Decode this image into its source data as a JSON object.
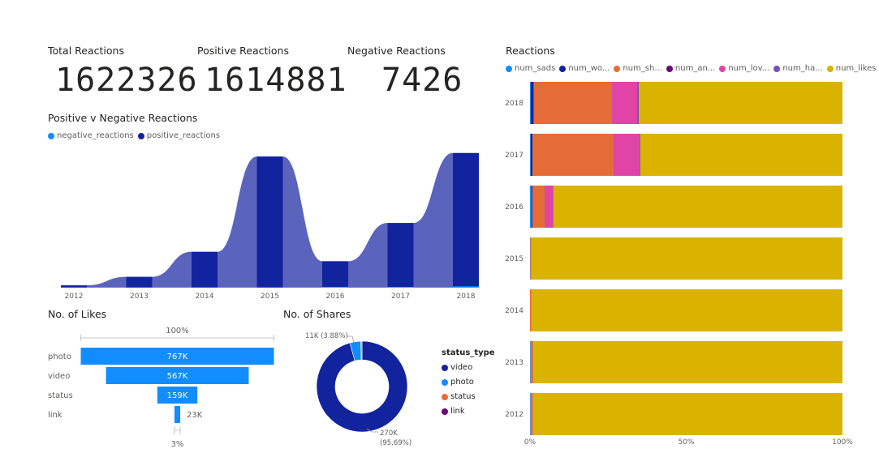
{
  "cards": [
    {
      "title": "Total Reactions",
      "value": "1622326"
    },
    {
      "title": "Positive Reactions",
      "value": "1614881"
    },
    {
      "title": "Negative Reactions",
      "value": "7426"
    }
  ],
  "ribbon_title": "Positive v Negative Reactions",
  "ribbon_legend": [
    {
      "label": "negative_reactions",
      "color": "#118dff"
    },
    {
      "label": "positive_reactions",
      "color": "#12239e"
    }
  ],
  "funnel_title": "No. of Likes",
  "donut_title": "No. of Shares",
  "bar_title": "Reactions",
  "bar_legend": [
    {
      "label": "num_sads",
      "color": "#118dff"
    },
    {
      "label": "num_wo...",
      "color": "#12239e"
    },
    {
      "label": "num_sh...",
      "color": "#e66c37"
    },
    {
      "label": "num_an...",
      "color": "#6b007b"
    },
    {
      "label": "num_lov...",
      "color": "#e044a7"
    },
    {
      "label": "num_ha...",
      "color": "#744ec2"
    },
    {
      "label": "num_likes",
      "color": "#d9b300"
    }
  ],
  "status_legend": {
    "title": "status_type",
    "items": [
      {
        "label": "video",
        "color": "#12239e"
      },
      {
        "label": "photo",
        "color": "#118dff"
      },
      {
        "label": "status",
        "color": "#e66c37"
      },
      {
        "label": "link",
        "color": "#6b007b"
      }
    ]
  },
  "chart_data": [
    {
      "type": "area",
      "title": "Positive v Negative Reactions",
      "categories": [
        "2012",
        "2013",
        "2014",
        "2015",
        "2016",
        "2017",
        "2018"
      ],
      "series": [
        {
          "name": "negative_reactions",
          "values": [
            0,
            0,
            0,
            0,
            100,
            1500,
            5800
          ]
        },
        {
          "name": "positive_reactions",
          "values": [
            10000,
            46000,
            152000,
            555000,
            112000,
            274000,
            570000
          ]
        }
      ]
    },
    {
      "type": "bar",
      "title": "No. of Likes",
      "categories": [
        "photo",
        "video",
        "status",
        "link"
      ],
      "values": [
        767,
        567,
        159,
        23
      ],
      "value_labels": [
        "767K",
        "567K",
        "159K",
        "23K"
      ],
      "top_label": "100%",
      "bottom_label": "3%"
    },
    {
      "type": "pie",
      "title": "No. of Shares",
      "categories": [
        "video",
        "photo",
        "status",
        "link"
      ],
      "values": [
        95.69,
        3.88,
        0.4,
        0.03
      ],
      "labels": [
        {
          "text": "270K",
          "pct": "(95.69%)"
        },
        {
          "text": "11K (3.88%)"
        }
      ]
    },
    {
      "type": "bar",
      "title": "Reactions",
      "stacked": "100%",
      "categories": [
        "2018",
        "2017",
        "2016",
        "2015",
        "2014",
        "2013",
        "2012"
      ],
      "series_order": [
        "num_sads",
        "num_wo...",
        "num_sh...",
        "num_an...",
        "num_lov...",
        "num_ha...",
        "num_likes"
      ],
      "values": [
        [
          0.2,
          1.0,
          25.0,
          0.1,
          8.0,
          0.5,
          65.2
        ],
        [
          0.2,
          0.6,
          26.0,
          0.1,
          8.0,
          0.4,
          64.7
        ],
        [
          0.5,
          0.3,
          4.0,
          0.1,
          2.5,
          0.1,
          92.5
        ],
        [
          0.1,
          0.0,
          0.3,
          0.0,
          0.0,
          0.0,
          99.6
        ],
        [
          0.0,
          0.0,
          0.4,
          0.0,
          0.0,
          0.0,
          99.6
        ],
        [
          0.2,
          0.0,
          0.9,
          0.0,
          0.0,
          0.0,
          98.9
        ],
        [
          0.2,
          0.0,
          0.8,
          0.0,
          0.0,
          0.0,
          99.0
        ]
      ],
      "x_ticks": [
        "0%",
        "50%",
        "100%"
      ],
      "xlim": [
        0,
        100
      ]
    }
  ]
}
